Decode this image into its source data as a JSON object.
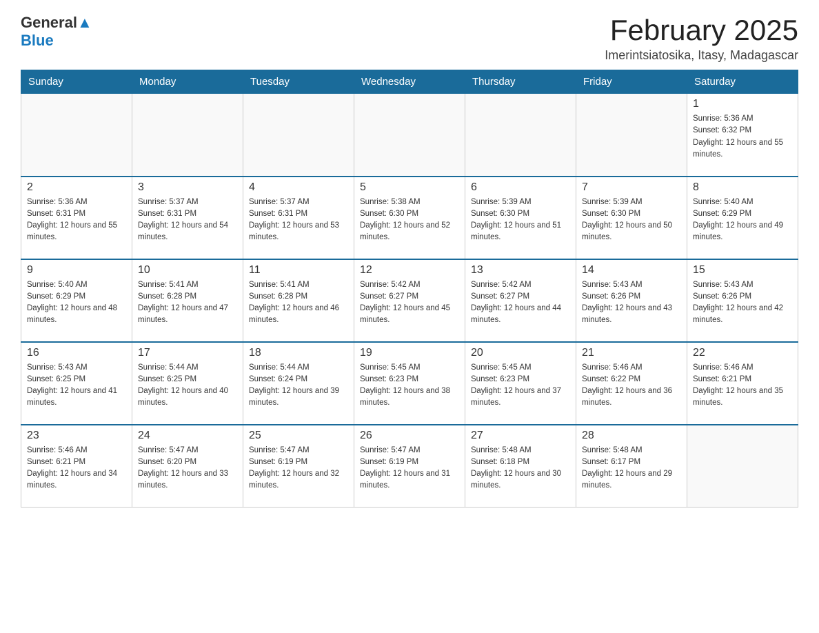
{
  "logo": {
    "general": "General",
    "blue": "Blue"
  },
  "title": "February 2025",
  "subtitle": "Imerintsiatosika, Itasy, Madagascar",
  "days_of_week": [
    "Sunday",
    "Monday",
    "Tuesday",
    "Wednesday",
    "Thursday",
    "Friday",
    "Saturday"
  ],
  "weeks": [
    [
      {
        "day": "",
        "info": ""
      },
      {
        "day": "",
        "info": ""
      },
      {
        "day": "",
        "info": ""
      },
      {
        "day": "",
        "info": ""
      },
      {
        "day": "",
        "info": ""
      },
      {
        "day": "",
        "info": ""
      },
      {
        "day": "1",
        "info": "Sunrise: 5:36 AM\nSunset: 6:32 PM\nDaylight: 12 hours and 55 minutes."
      }
    ],
    [
      {
        "day": "2",
        "info": "Sunrise: 5:36 AM\nSunset: 6:31 PM\nDaylight: 12 hours and 55 minutes."
      },
      {
        "day": "3",
        "info": "Sunrise: 5:37 AM\nSunset: 6:31 PM\nDaylight: 12 hours and 54 minutes."
      },
      {
        "day": "4",
        "info": "Sunrise: 5:37 AM\nSunset: 6:31 PM\nDaylight: 12 hours and 53 minutes."
      },
      {
        "day": "5",
        "info": "Sunrise: 5:38 AM\nSunset: 6:30 PM\nDaylight: 12 hours and 52 minutes."
      },
      {
        "day": "6",
        "info": "Sunrise: 5:39 AM\nSunset: 6:30 PM\nDaylight: 12 hours and 51 minutes."
      },
      {
        "day": "7",
        "info": "Sunrise: 5:39 AM\nSunset: 6:30 PM\nDaylight: 12 hours and 50 minutes."
      },
      {
        "day": "8",
        "info": "Sunrise: 5:40 AM\nSunset: 6:29 PM\nDaylight: 12 hours and 49 minutes."
      }
    ],
    [
      {
        "day": "9",
        "info": "Sunrise: 5:40 AM\nSunset: 6:29 PM\nDaylight: 12 hours and 48 minutes."
      },
      {
        "day": "10",
        "info": "Sunrise: 5:41 AM\nSunset: 6:28 PM\nDaylight: 12 hours and 47 minutes."
      },
      {
        "day": "11",
        "info": "Sunrise: 5:41 AM\nSunset: 6:28 PM\nDaylight: 12 hours and 46 minutes."
      },
      {
        "day": "12",
        "info": "Sunrise: 5:42 AM\nSunset: 6:27 PM\nDaylight: 12 hours and 45 minutes."
      },
      {
        "day": "13",
        "info": "Sunrise: 5:42 AM\nSunset: 6:27 PM\nDaylight: 12 hours and 44 minutes."
      },
      {
        "day": "14",
        "info": "Sunrise: 5:43 AM\nSunset: 6:26 PM\nDaylight: 12 hours and 43 minutes."
      },
      {
        "day": "15",
        "info": "Sunrise: 5:43 AM\nSunset: 6:26 PM\nDaylight: 12 hours and 42 minutes."
      }
    ],
    [
      {
        "day": "16",
        "info": "Sunrise: 5:43 AM\nSunset: 6:25 PM\nDaylight: 12 hours and 41 minutes."
      },
      {
        "day": "17",
        "info": "Sunrise: 5:44 AM\nSunset: 6:25 PM\nDaylight: 12 hours and 40 minutes."
      },
      {
        "day": "18",
        "info": "Sunrise: 5:44 AM\nSunset: 6:24 PM\nDaylight: 12 hours and 39 minutes."
      },
      {
        "day": "19",
        "info": "Sunrise: 5:45 AM\nSunset: 6:23 PM\nDaylight: 12 hours and 38 minutes."
      },
      {
        "day": "20",
        "info": "Sunrise: 5:45 AM\nSunset: 6:23 PM\nDaylight: 12 hours and 37 minutes."
      },
      {
        "day": "21",
        "info": "Sunrise: 5:46 AM\nSunset: 6:22 PM\nDaylight: 12 hours and 36 minutes."
      },
      {
        "day": "22",
        "info": "Sunrise: 5:46 AM\nSunset: 6:21 PM\nDaylight: 12 hours and 35 minutes."
      }
    ],
    [
      {
        "day": "23",
        "info": "Sunrise: 5:46 AM\nSunset: 6:21 PM\nDaylight: 12 hours and 34 minutes."
      },
      {
        "day": "24",
        "info": "Sunrise: 5:47 AM\nSunset: 6:20 PM\nDaylight: 12 hours and 33 minutes."
      },
      {
        "day": "25",
        "info": "Sunrise: 5:47 AM\nSunset: 6:19 PM\nDaylight: 12 hours and 32 minutes."
      },
      {
        "day": "26",
        "info": "Sunrise: 5:47 AM\nSunset: 6:19 PM\nDaylight: 12 hours and 31 minutes."
      },
      {
        "day": "27",
        "info": "Sunrise: 5:48 AM\nSunset: 6:18 PM\nDaylight: 12 hours and 30 minutes."
      },
      {
        "day": "28",
        "info": "Sunrise: 5:48 AM\nSunset: 6:17 PM\nDaylight: 12 hours and 29 minutes."
      },
      {
        "day": "",
        "info": ""
      }
    ]
  ]
}
